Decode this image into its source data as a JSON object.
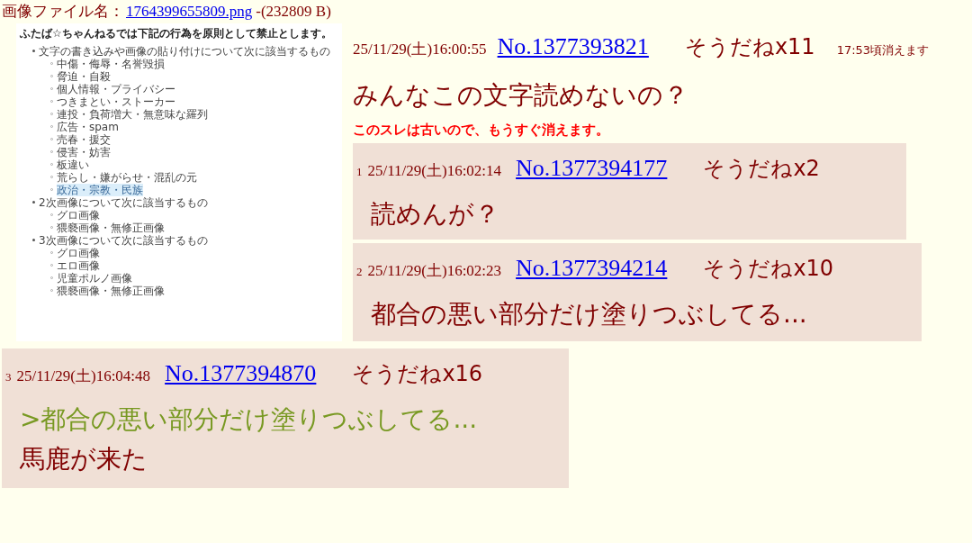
{
  "file": {
    "label": "画像ファイル名：",
    "name": "1764399655809.png",
    "size": "-(232809 B)"
  },
  "thumbnail": {
    "title": "ふたば☆ちゃんねるでは下記の行為を原則として禁止とします。",
    "sections": [
      {
        "text": "文字の書き込みや画像の貼り付けについて次に該当するもの",
        "children": [
          {
            "text": "中傷・侮辱・名誉毀損",
            "highlighted": false
          },
          {
            "text": "脅迫・自殺",
            "highlighted": false
          },
          {
            "text": "個人情報・プライバシー",
            "highlighted": false
          },
          {
            "text": "つきまとい・ストーカー",
            "highlighted": false
          },
          {
            "text": "連投・負荷増大・無意味な羅列",
            "highlighted": false
          },
          {
            "text": "広告・spam",
            "highlighted": false
          },
          {
            "text": "売春・援交",
            "highlighted": false
          },
          {
            "text": "侵害・妨害",
            "highlighted": false
          },
          {
            "text": "板違い",
            "highlighted": false
          },
          {
            "text": "荒らし・嫌がらせ・混乱の元",
            "highlighted": false
          },
          {
            "text": "政治・宗教・民族",
            "highlighted": true
          }
        ]
      },
      {
        "text": "2次画像について次に該当するもの",
        "children": [
          {
            "text": "グロ画像",
            "highlighted": false
          },
          {
            "text": "猥褻画像・無修正画像",
            "highlighted": false
          }
        ]
      },
      {
        "text": "3次画像について次に該当するもの",
        "children": [
          {
            "text": "グロ画像",
            "highlighted": false
          },
          {
            "text": "エロ画像",
            "highlighted": false
          },
          {
            "text": "児童ポルノ画像",
            "highlighted": false
          },
          {
            "text": "猥褻画像・無修正画像",
            "highlighted": false
          }
        ]
      }
    ]
  },
  "op": {
    "date": "25/11/29(土)16:00:55",
    "number": "No.1377393821",
    "sodane": "そうだねx11",
    "expires": "17:53頃消えます",
    "body": "みんなこの文字読めないの？"
  },
  "warning": "このスレは古いので、もうすぐ消えます。",
  "replies": [
    {
      "index": "1",
      "date": "25/11/29(土)16:02:14",
      "number": "No.1377394177",
      "sodane": "そうだねx2",
      "lines": [
        {
          "kind": "text",
          "text": "読めんが？"
        }
      ]
    },
    {
      "index": "2",
      "date": "25/11/29(土)16:02:23",
      "number": "No.1377394214",
      "sodane": "そうだねx10",
      "lines": [
        {
          "kind": "text",
          "text": "都合の悪い部分だけ塗りつぶしてる..."
        }
      ]
    },
    {
      "index": "3",
      "date": "25/11/29(土)16:04:48",
      "number": "No.1377394870",
      "sodane": "そうだねx16",
      "lines": [
        {
          "kind": "quote",
          "text": ">都合の悪い部分だけ塗りつぶしてる..."
        },
        {
          "kind": "text",
          "text": "馬鹿が来た"
        }
      ]
    }
  ]
}
